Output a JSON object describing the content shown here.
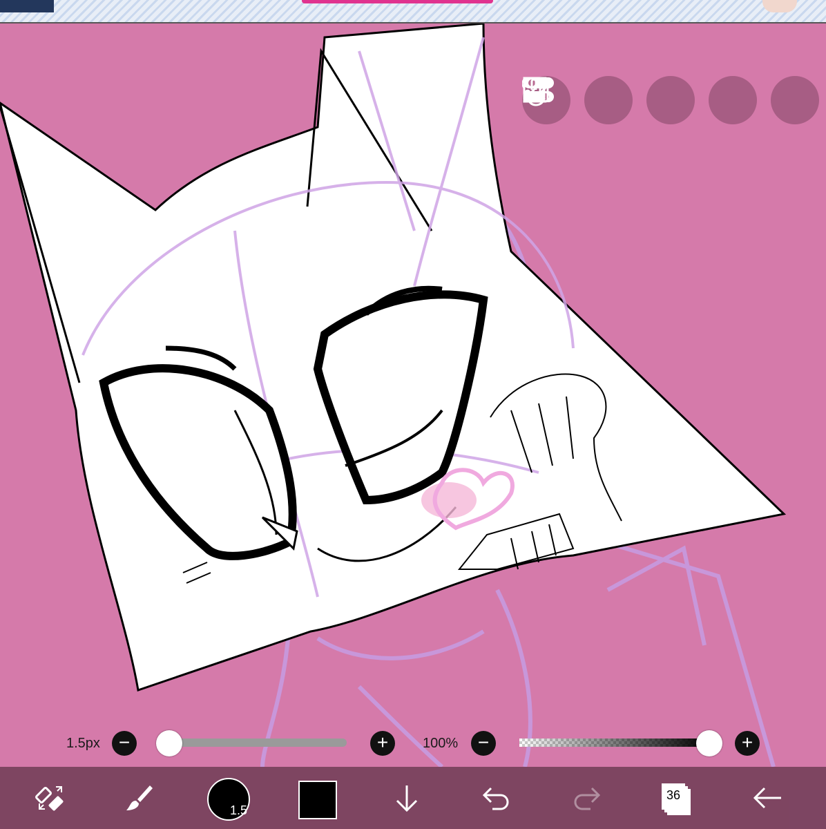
{
  "brush": {
    "size_label": "1.5px",
    "size_level": 0.0,
    "opacity_label": "100%",
    "opacity_level": 1.0,
    "minus_symbol": "−",
    "plus_symbol": "+"
  },
  "toolbar": {
    "brush_size_value": "1.5",
    "layer_count": "36",
    "color_hex": "#000000"
  },
  "canvas": {
    "background_color": "#d57aaa"
  },
  "icons": {
    "top_tools": [
      "toggle-icon",
      "selection-icon",
      "hand-scroll-icon",
      "ruler-icon",
      "image-icon"
    ],
    "bottom_tools": [
      "transform-icon",
      "brush-icon",
      "brush-size-icon",
      "color-icon",
      "layer-down-icon",
      "undo-icon",
      "redo-icon",
      "layers-icon",
      "back-icon"
    ]
  }
}
